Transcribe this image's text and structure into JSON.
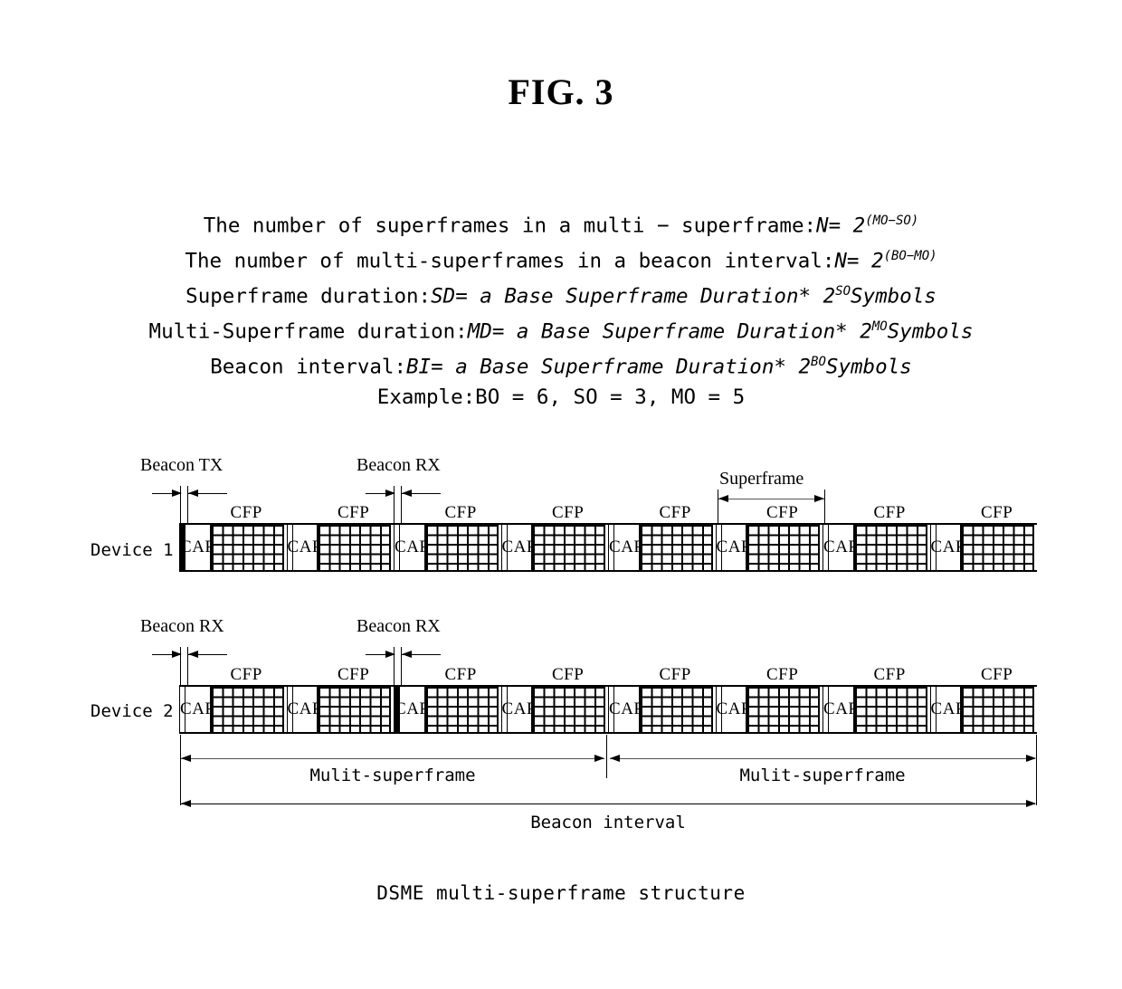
{
  "figure": {
    "title": "FIG. 3",
    "caption": "DSME multi-superframe structure"
  },
  "formulas": [
    {
      "id": "superframes-in-multi-superframe",
      "label": "The number of superframes in a multi − superframe:",
      "var": "N",
      "eq": "= 2",
      "exponent": "(MO−SO)",
      "unit": ""
    },
    {
      "id": "multi-superframes-in-beacon-interval",
      "label": "The number of multi-superframes in a beacon interval:",
      "var": "N",
      "eq": "= 2",
      "exponent": "(BO−MO)",
      "unit": ""
    },
    {
      "id": "superframe-duration",
      "label": "Superframe duration:",
      "var": "SD",
      "eq": "= a Base Superframe Duration* 2",
      "exponent": "SO",
      "unit": "Symbols"
    },
    {
      "id": "multi-superframe-duration",
      "label": "Multi-Superframe duration:",
      "var": "MD",
      "eq": "= a Base Superframe Duration* 2",
      "exponent": "MO",
      "unit": "Symbols"
    },
    {
      "id": "beacon-interval",
      "label": "Beacon interval:",
      "var": "BI",
      "eq": "= a Base Superframe Duration* 2",
      "exponent": "BO",
      "unit": "Symbols"
    }
  ],
  "example": {
    "label": "Example:",
    "text": "BO = 6, SO = 3, MO = 5",
    "BO": 6,
    "SO": 3,
    "MO": 5
  },
  "diagram": {
    "cap_label": "CAP",
    "cfp_label": "CFP",
    "superframe_bracket_label": "Superframe",
    "rows": [
      {
        "id": "device-1",
        "label": "Device 1",
        "beacon_callouts": [
          {
            "id": "beacon-tx",
            "text": "Beacon TX",
            "superframe_index": 0
          },
          {
            "id": "beacon-rx",
            "text": "Beacon RX",
            "superframe_index": 2
          }
        ],
        "superframes": [
          {
            "index": 0,
            "beacon": "tx"
          },
          {
            "index": 1,
            "beacon": "rx"
          },
          {
            "index": 2,
            "beacon": "rx"
          },
          {
            "index": 3,
            "beacon": "rx"
          },
          {
            "index": 4,
            "beacon": "rx"
          },
          {
            "index": 5,
            "beacon": "rx"
          },
          {
            "index": 6,
            "beacon": "rx"
          },
          {
            "index": 7,
            "beacon": "rx"
          }
        ]
      },
      {
        "id": "device-2",
        "label": "Device 2",
        "beacon_callouts": [
          {
            "id": "beacon-rx-1",
            "text": "Beacon RX",
            "superframe_index": 0
          },
          {
            "id": "beacon-rx-2",
            "text": "Beacon RX",
            "superframe_index": 2
          }
        ],
        "superframes": [
          {
            "index": 0,
            "beacon": "rx"
          },
          {
            "index": 1,
            "beacon": "rx"
          },
          {
            "index": 2,
            "beacon": "tx"
          },
          {
            "index": 3,
            "beacon": "rx"
          },
          {
            "index": 4,
            "beacon": "rx"
          },
          {
            "index": 5,
            "beacon": "rx"
          },
          {
            "index": 6,
            "beacon": "rx"
          },
          {
            "index": 7,
            "beacon": "rx"
          }
        ]
      }
    ],
    "spans": [
      {
        "id": "multi-superframe-1",
        "label": "Mulit-superframe"
      },
      {
        "id": "multi-superframe-2",
        "label": "Mulit-superframe"
      },
      {
        "id": "beacon-interval",
        "label": "Beacon interval"
      }
    ]
  },
  "colors": {
    "ink": "#000000",
    "paper": "#ffffff",
    "leader": "#555555"
  }
}
